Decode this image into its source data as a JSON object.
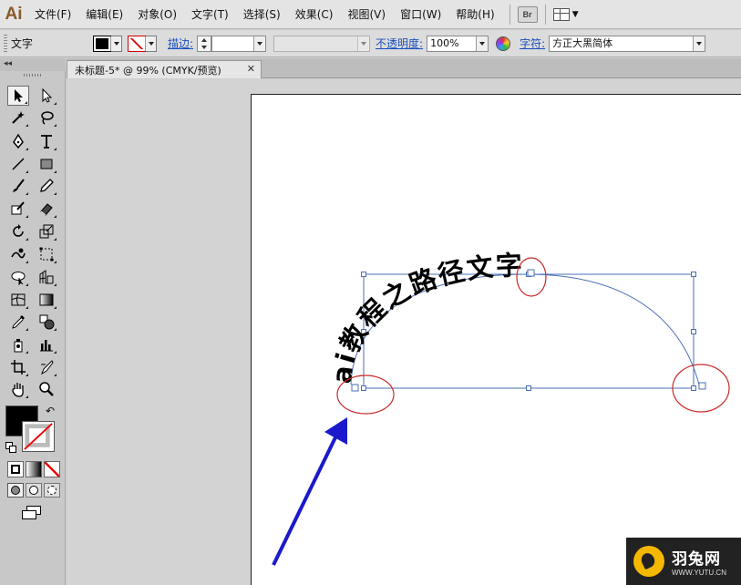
{
  "app": {
    "logo": "Ai"
  },
  "menu": [
    "文件(F)",
    "编辑(E)",
    "对象(O)",
    "文字(T)",
    "选择(S)",
    "效果(C)",
    "视图(V)",
    "窗口(W)",
    "帮助(H)"
  ],
  "menubar": {
    "bridge_label": "Br"
  },
  "control": {
    "object_type": "文字",
    "stroke_label": "描边:",
    "opacity_label": "不透明度:",
    "opacity_value": "100%",
    "char_label": "字符:",
    "font_value": "方正大黑简体"
  },
  "document": {
    "tab_title": "未标题-5* @ 99% (CMYK/预览)",
    "close_glyph": "✕"
  },
  "artwork": {
    "path_text": "ai教程之路径文字"
  },
  "watermark": {
    "brand": "羽兔网",
    "url": "WWW.YUTU.CN"
  },
  "colors": {
    "fill": "#000000",
    "stroke": "none",
    "selection": "#4a6fb5",
    "annotation_circle": "#cc2a2a",
    "arrow": "#1a1acc"
  },
  "icons": {
    "tools": [
      "selection-tool-icon",
      "direct-selection-tool-icon",
      "magic-wand-tool-icon",
      "lasso-tool-icon",
      "pen-tool-icon",
      "type-tool-icon",
      "line-tool-icon",
      "rectangle-tool-icon",
      "paintbrush-tool-icon",
      "pencil-tool-icon",
      "blob-brush-tool-icon",
      "eraser-tool-icon",
      "rotate-tool-icon",
      "scale-tool-icon",
      "warp-tool-icon",
      "free-transform-tool-icon",
      "shape-builder-tool-icon",
      "perspective-grid-tool-icon",
      "mesh-tool-icon",
      "gradient-tool-icon",
      "eyedropper-tool-icon",
      "blend-tool-icon",
      "symbol-sprayer-tool-icon",
      "column-graph-tool-icon",
      "artboard-tool-icon",
      "slice-tool-icon",
      "hand-tool-icon",
      "zoom-tool-icon"
    ]
  }
}
